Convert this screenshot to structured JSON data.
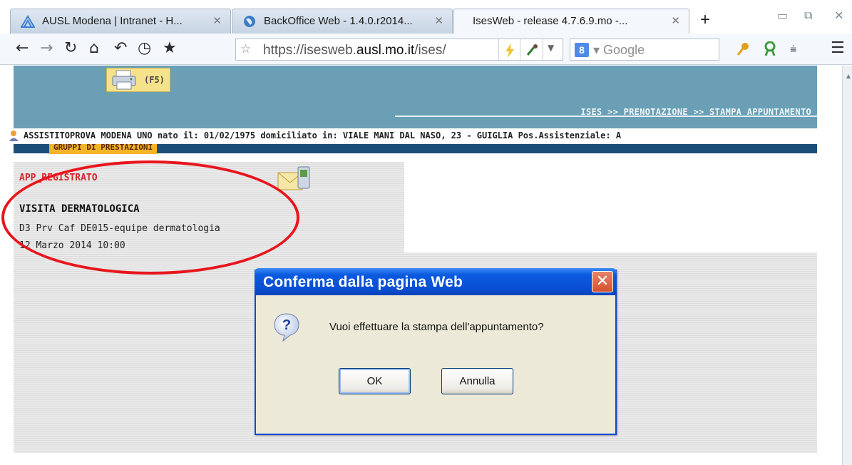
{
  "browser": {
    "tabs": [
      {
        "label": "AUSL Modena | Intranet - H...",
        "icon": "ausl-logo-icon"
      },
      {
        "label": "BackOffice Web - 1.4.0.r2014...",
        "icon": "globe-icon"
      },
      {
        "label": "IsesWeb - release 4.7.6.9.mo -...",
        "icon": ""
      }
    ],
    "url": {
      "prefix": "https://isesweb.",
      "domain": "ausl.mo.it",
      "suffix": "/ises/"
    },
    "search_placeholder": "Google",
    "search_engine_letter": "8"
  },
  "page": {
    "f5_label": "(F5)",
    "breadcrumb": "ISES >> PRENOTAZIONE >> STAMPA APPUNTAMENTO",
    "patient_info": "ASSISTITOPROVA MODENA UNO  nato il: 01/02/1975  domiciliato in: VIALE MANI DAL NASO, 23 - GUIGLIA Pos.Assistenziale: A",
    "section_tab": "GRUPPI DI PRESTAZIONI",
    "appointment": {
      "status": "APP_REGISTRATO",
      "visit": "VISITA DERMATOLOGICA",
      "equipe": "D3 Prv Caf DE015-equipe dermatologia",
      "datetime": "12 Marzo 2014 10:00"
    }
  },
  "dialog": {
    "title": "Conferma dalla pagina Web",
    "message": "Vuoi effettuare la stampa dell'appuntamento?",
    "ok_label": "OK",
    "cancel_label": "Annulla"
  }
}
